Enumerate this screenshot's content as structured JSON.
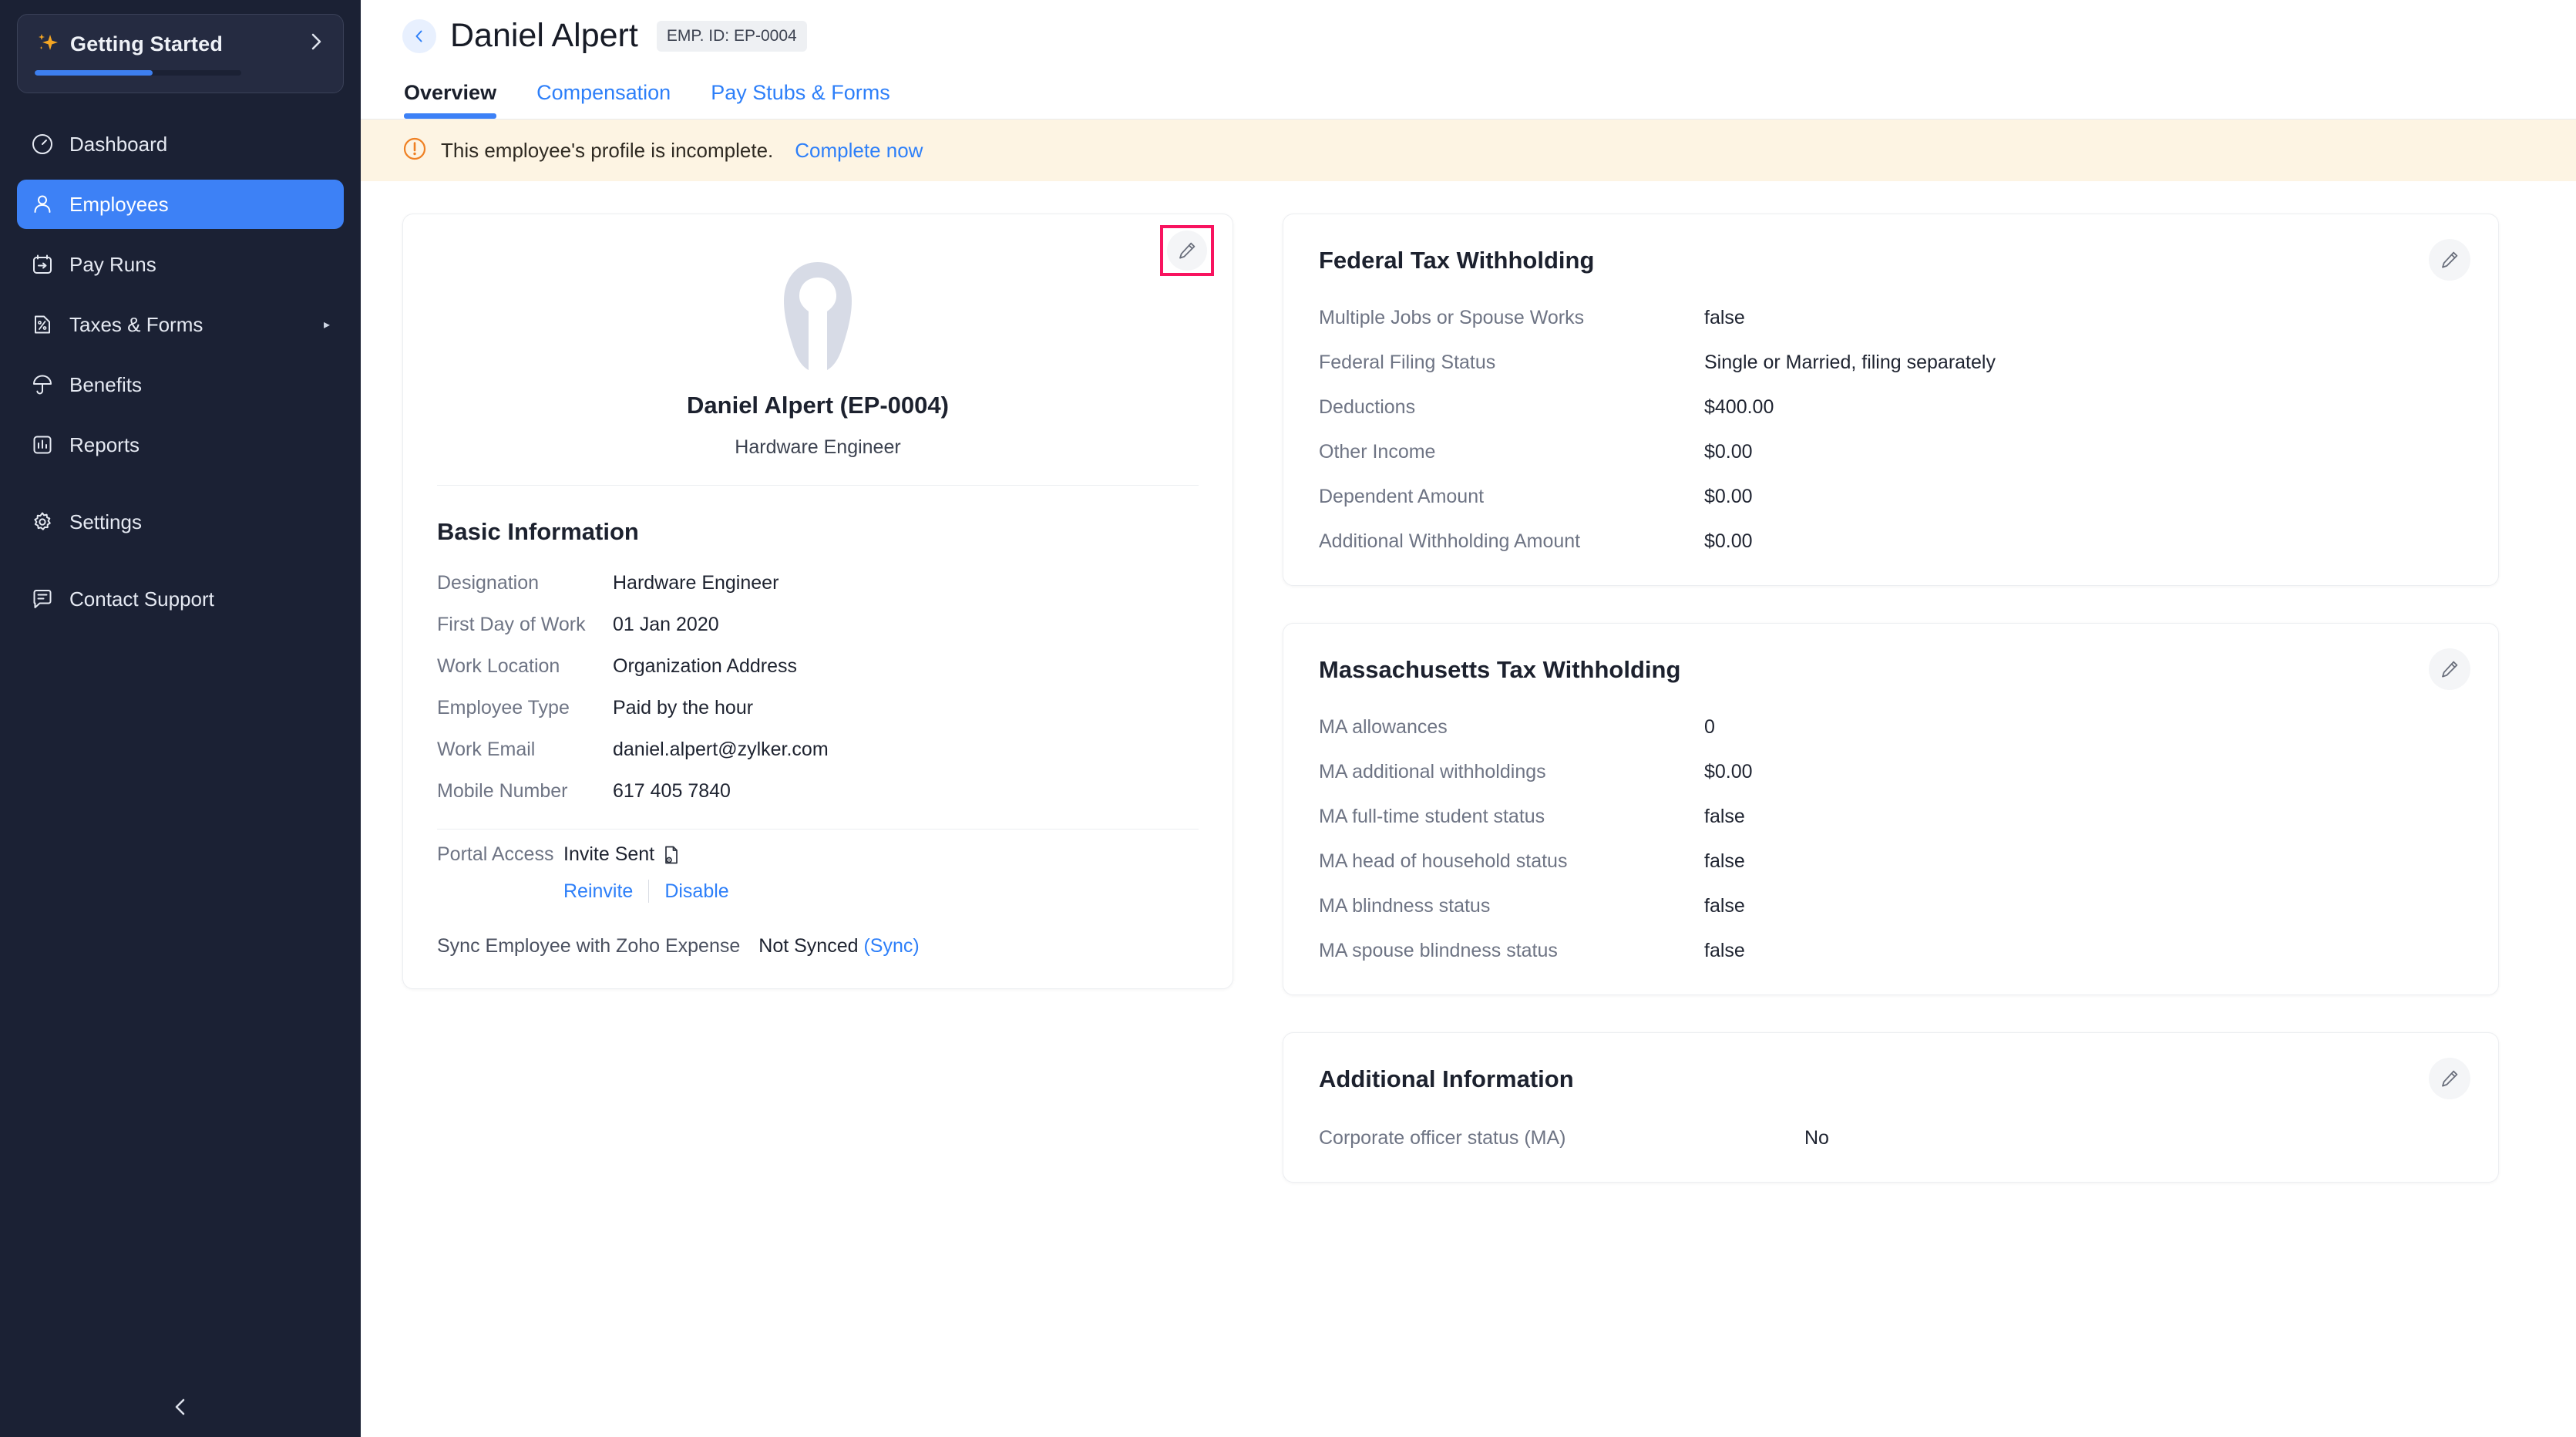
{
  "sidebar": {
    "getting_started": {
      "label": "Getting Started",
      "progress_percent": 57,
      "chevron": "›"
    },
    "items": [
      {
        "label": "Dashboard",
        "icon": "gauge-icon",
        "active": false,
        "has_caret": false
      },
      {
        "label": "Employees",
        "icon": "user-icon",
        "active": true,
        "has_caret": false
      },
      {
        "label": "Pay Runs",
        "icon": "calendar-arrow-icon",
        "active": false,
        "has_caret": false
      },
      {
        "label": "Taxes & Forms",
        "icon": "tax-doc-icon",
        "active": false,
        "has_caret": true
      },
      {
        "label": "Benefits",
        "icon": "umbrella-icon",
        "active": false,
        "has_caret": false
      },
      {
        "label": "Reports",
        "icon": "bar-chart-icon",
        "active": false,
        "has_caret": false
      },
      {
        "label": "Settings",
        "icon": "gear-icon",
        "active": false,
        "has_caret": false
      },
      {
        "label": "Contact Support",
        "icon": "chat-icon",
        "active": false,
        "has_caret": false
      }
    ],
    "collapse_icon": "chevron-left-icon"
  },
  "header": {
    "back_icon": "chevron-left-icon",
    "title": "Daniel Alpert",
    "employee_id_badge": "EMP. ID: EP-0004"
  },
  "tabs": [
    {
      "label": "Overview",
      "active": true
    },
    {
      "label": "Compensation",
      "active": false
    },
    {
      "label": "Pay Stubs & Forms",
      "active": false
    }
  ],
  "banner": {
    "icon": "alert-circle-icon",
    "message": "This employee's profile is incomplete.",
    "link": "Complete now",
    "bg": "#fdf4e3",
    "icon_color": "#ef8023"
  },
  "profile": {
    "edit_icon": "pencil-icon",
    "highlight_color": "#f8135f",
    "avatar_icon": "user-avatar-placeholder",
    "name": "Daniel Alpert (EP-0004)",
    "role": "Hardware Engineer",
    "basic_information": {
      "title": "Basic Information",
      "rows": [
        {
          "label": "Designation",
          "value": "Hardware Engineer"
        },
        {
          "label": "First Day of Work",
          "value": "01 Jan 2020"
        },
        {
          "label": "Work Location",
          "value": "Organization Address"
        },
        {
          "label": "Employee Type",
          "value": "Paid by the hour"
        },
        {
          "label": "Work Email",
          "value": "daniel.alpert@zylker.com"
        },
        {
          "label": "Mobile Number",
          "value": "617 405 7840"
        }
      ]
    },
    "portal_access": {
      "label": "Portal Access",
      "status": "Invite Sent",
      "status_icon": "invite-doc-icon",
      "reinvite": "Reinvite",
      "disable": "Disable"
    },
    "sync": {
      "label": "Sync Employee with Zoho Expense",
      "status": "Not Synced",
      "action": "(Sync)"
    }
  },
  "federal_tax": {
    "title": "Federal Tax Withholding",
    "edit_icon": "pencil-icon",
    "rows": [
      {
        "label": "Multiple Jobs or Spouse Works",
        "value": "false"
      },
      {
        "label": "Federal Filing Status",
        "value": "Single or Married, filing separately"
      },
      {
        "label": "Deductions",
        "value": "$400.00"
      },
      {
        "label": "Other Income",
        "value": "$0.00"
      },
      {
        "label": "Dependent Amount",
        "value": "$0.00"
      },
      {
        "label": "Additional Withholding Amount",
        "value": "$0.00"
      }
    ]
  },
  "state_tax": {
    "title": "Massachusetts Tax Withholding",
    "edit_icon": "pencil-icon",
    "rows": [
      {
        "label": "MA allowances",
        "value": "0"
      },
      {
        "label": "MA additional withholdings",
        "value": "$0.00"
      },
      {
        "label": "MA full-time student status",
        "value": "false"
      },
      {
        "label": "MA head of household status",
        "value": "false"
      },
      {
        "label": "MA blindness status",
        "value": "false"
      },
      {
        "label": "MA spouse blindness status",
        "value": "false"
      }
    ]
  },
  "additional_information": {
    "title": "Additional Information",
    "edit_icon": "pencil-icon",
    "rows": [
      {
        "label": "Corporate officer status (MA)",
        "value": "No"
      }
    ]
  },
  "colors": {
    "sidebar_bg": "#1b2134",
    "sidebar_active": "#3d81f6",
    "link_blue": "#2d7ff9",
    "highlight_pink": "#f8135f",
    "banner_bg": "#fdf4e3"
  }
}
